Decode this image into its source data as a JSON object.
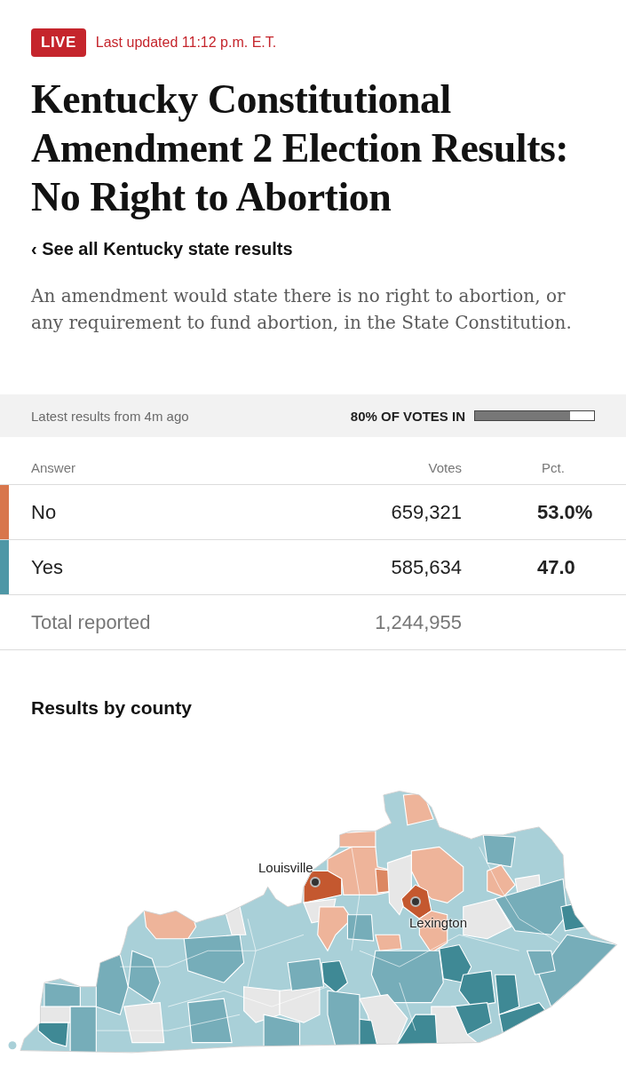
{
  "live_badge": {
    "label": "LIVE"
  },
  "last_updated": "Last updated 11:12 p.m. E.T.",
  "headline": "Kentucky Constitutional Amendment 2 Election Results: No Right to Abortion",
  "back_link": {
    "label": "‹ See all Kentucky state results"
  },
  "description": "An amendment would state there is no right to abortion, or any requirement to fund abortion, in the State Constitution.",
  "status_bar": {
    "latest": "Latest results from 4m ago",
    "votes_in": "80% OF VOTES IN",
    "level": 0.8
  },
  "results_table": {
    "columns": [
      "Answer",
      "Votes",
      "Pct."
    ],
    "rows": [
      {
        "answer": "No",
        "votes": "659,321",
        "pct": "53.0%",
        "color": "#d8764c"
      },
      {
        "answer": "Yes",
        "votes": "585,634",
        "pct": "47.0",
        "color": "#4e97a6"
      }
    ],
    "total": {
      "label": "Total reported",
      "votes": "1,244,955"
    }
  },
  "county_map": {
    "title": "Results by county",
    "cities": [
      {
        "label": "Louisville"
      },
      {
        "label": "Lexington"
      }
    ]
  }
}
